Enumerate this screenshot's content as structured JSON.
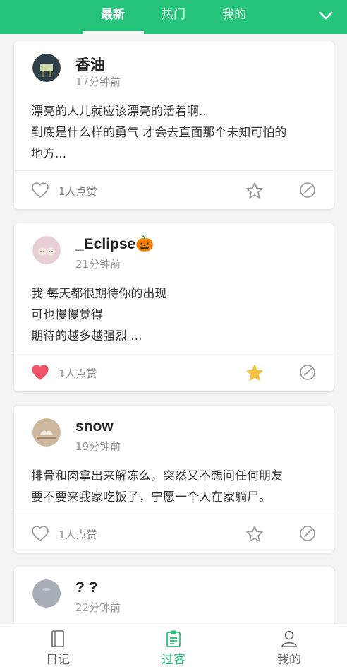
{
  "header": {
    "tabs": [
      {
        "label": "最新",
        "active": true
      },
      {
        "label": "热门",
        "active": false
      },
      {
        "label": "我的",
        "active": false
      }
    ],
    "expand_icon": "chevron-down-icon"
  },
  "posts": [
    {
      "username": "香油",
      "time": "17分钟前",
      "lines": [
        "漂亮的人儿就应该漂亮的活着啊..",
        "到底是什么样的勇气 才会去直面那个未知可怕的",
        "地方..."
      ],
      "likes": "1人点赞",
      "liked": false,
      "starred": false
    },
    {
      "username": "_Eclipse🎃",
      "time": "21分钟前",
      "lines": [
        "我 每天都很期待你的出现",
        "可也慢慢觉得",
        "期待的越多越强烈 ..."
      ],
      "likes": "1人点赞",
      "liked": true,
      "starred": true
    },
    {
      "username": "snow",
      "time": "19分钟前",
      "lines": [
        "排骨和肉拿出来解冻么，突然又不想问任何朋友",
        "要不要来我家吃饭了，宁愿一个人在家躺尸。"
      ],
      "likes": "1人点赞",
      "liked": false,
      "starred": false
    },
    {
      "username": "? ?",
      "time": "22分钟前",
      "lines": [],
      "likes": "",
      "liked": false,
      "starred": false
    }
  ],
  "bottom_nav": [
    {
      "label": "日记",
      "icon": "diary-icon",
      "active": false
    },
    {
      "label": "过客",
      "icon": "passerby-icon",
      "active": true
    },
    {
      "label": "我的",
      "icon": "profile-icon",
      "active": false
    }
  ],
  "colors": {
    "accent": "#26c47a",
    "heart_active": "#f0546a",
    "star_active": "#f5c341"
  }
}
